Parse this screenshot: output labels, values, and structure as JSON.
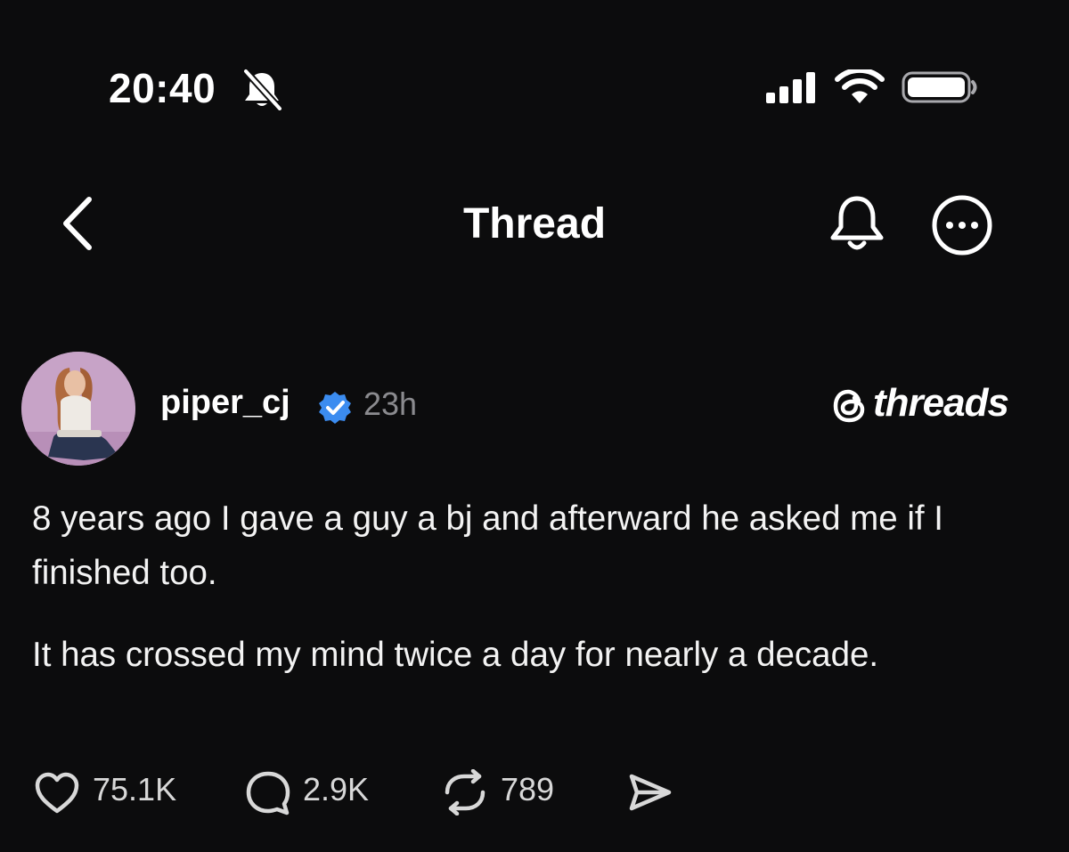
{
  "status_bar": {
    "time": "20:40",
    "silent_icon": "bell-slash-icon",
    "signal_icon": "cellular-signal-icon",
    "wifi_icon": "wifi-icon",
    "battery_icon": "battery-icon"
  },
  "nav": {
    "back_icon": "chevron-left-icon",
    "title": "Thread",
    "notify_icon": "bell-icon",
    "more_icon": "more-options-icon"
  },
  "post": {
    "avatar_icon": "profile-photo",
    "username": "piper_cj",
    "verified_icon": "verified-badge-icon",
    "time_ago": "23h",
    "brand": "threads",
    "brand_logo_icon": "threads-logo-icon",
    "paragraphs": [
      "8 years ago I gave a guy a bj and afterward he asked me if I finished too.",
      "It has crossed my mind twice a day for nearly a decade."
    ]
  },
  "actions": {
    "like": {
      "icon": "heart-icon",
      "count": "75.1K"
    },
    "reply": {
      "icon": "comment-icon",
      "count": "2.9K"
    },
    "repost": {
      "icon": "repost-icon",
      "count": "789"
    },
    "share": {
      "icon": "send-icon"
    }
  },
  "colors": {
    "background": "#0c0c0d",
    "text": "#f3f3f3",
    "muted": "#8b8b8f",
    "verified": "#3b8cf0"
  }
}
